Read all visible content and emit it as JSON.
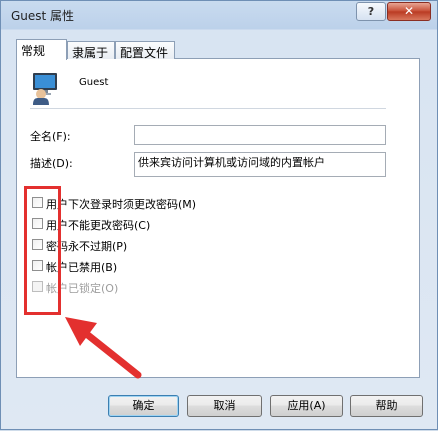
{
  "window": {
    "title": "Guest 属性",
    "help_label": "?",
    "close_label": "✕"
  },
  "tabs": [
    "常规",
    "隶属于",
    "配置文件"
  ],
  "general": {
    "user_name": "Guest",
    "full_name_label": "全名(F):",
    "full_name_value": "",
    "description_label": "描述(D):",
    "description_value": "供来宾访问计算机或访问域的内置帐户"
  },
  "options": [
    {
      "label": "用户下次登录时须更改密码(M)",
      "checked": false,
      "disabled": false
    },
    {
      "label": "用户不能更改密码(C)",
      "checked": false,
      "disabled": false
    },
    {
      "label": "密码永不过期(P)",
      "checked": false,
      "disabled": false
    },
    {
      "label": "帐户已禁用(B)",
      "checked": false,
      "disabled": false
    },
    {
      "label": "帐户已锁定(O)",
      "checked": false,
      "disabled": true
    }
  ],
  "buttons": {
    "ok": "确定",
    "cancel": "取消",
    "apply": "应用(A)",
    "help": "帮助"
  },
  "annotation": {
    "highlight_color": "#e3302f"
  }
}
